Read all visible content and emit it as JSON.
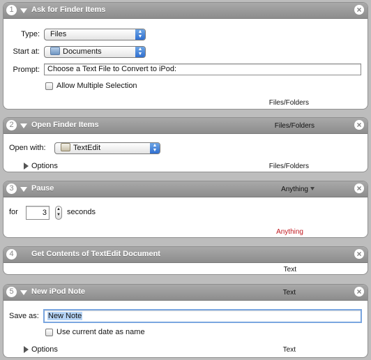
{
  "actions": [
    {
      "number": "1",
      "title": "Ask for Finder Items",
      "type_label": "Type:",
      "type_value": "Files",
      "start_label": "Start at:",
      "start_value": "Documents",
      "prompt_label": "Prompt:",
      "prompt_value": "Choose a Text File to Convert to iPod:",
      "allow_multiple_label": "Allow Multiple Selection",
      "output": "Files/Folders"
    },
    {
      "number": "2",
      "title": "Open Finder Items",
      "input": "Files/Folders",
      "open_with_label": "Open with:",
      "open_with_value": "TextEdit",
      "options_label": "Options",
      "output": "Files/Folders"
    },
    {
      "number": "3",
      "title": "Pause",
      "input": "Anything",
      "for_label": "for",
      "seconds_value": "3",
      "seconds_label": "seconds",
      "output": "Anything"
    },
    {
      "number": "4",
      "title": "Get Contents of TextEdit Document",
      "output": "Text"
    },
    {
      "number": "5",
      "title": "New iPod Note",
      "input": "Text",
      "save_as_label": "Save as:",
      "save_as_value": "New Note",
      "use_date_label": "Use current date as name",
      "options_label": "Options",
      "output": "Text"
    }
  ],
  "icons": {
    "close": "close-icon",
    "disclosure_open": "disclosure-down-icon",
    "disclosure_closed": "disclosure-right-icon"
  },
  "colors": {
    "header_gray": "#9b9b9b",
    "anything_output": "#c0181f",
    "popup_blue": "#2f6fd0"
  }
}
